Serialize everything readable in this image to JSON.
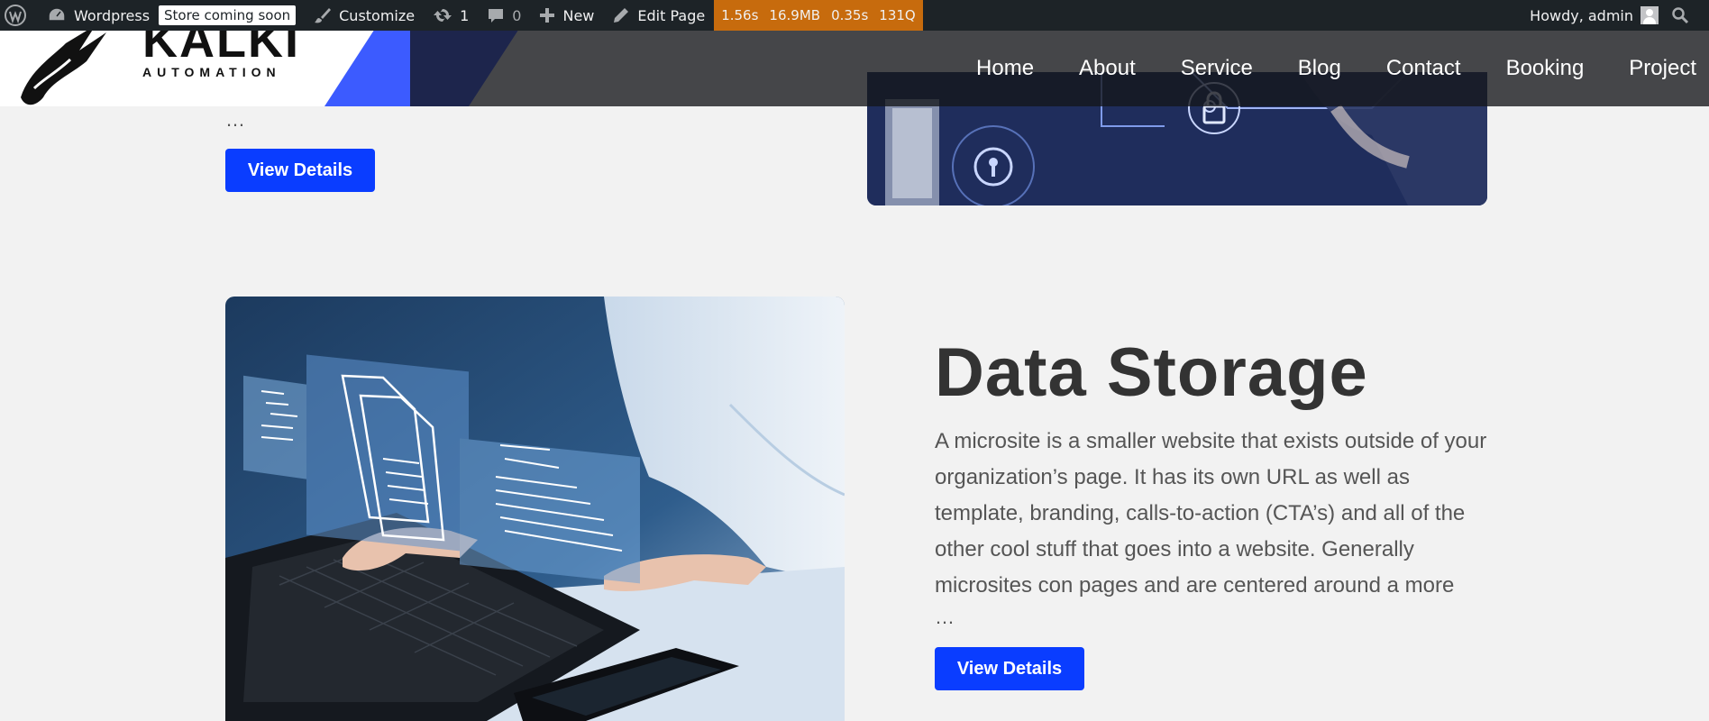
{
  "adminbar": {
    "site_name": "Wordpress",
    "store_badge": "Store coming soon",
    "customize": "Customize",
    "updates_count": "1",
    "comments_count": "0",
    "new_label": "New",
    "edit_page": "Edit Page",
    "perf": [
      "1.56s",
      "16.9MB",
      "0.35s",
      "131Q"
    ],
    "howdy": "Howdy, admin"
  },
  "header": {
    "logo_text": "KALKI",
    "logo_sub": "AUTOMATION",
    "nav": [
      "Home",
      "About",
      "Service",
      "Blog",
      "Contact",
      "Booking",
      "Project"
    ]
  },
  "previous_item": {
    "ellipsis": "…",
    "button": "View Details"
  },
  "service": {
    "title": "Data Storage",
    "description": "A microsite is a smaller website that exists outside of your organization’s page. It has its own URL as well as template, branding, calls-to-action (CTA’s) and all of the other cool stuff that goes into a website. Generally microsites con pages and are centered around a more",
    "ellipsis": "…",
    "button": "View Details"
  },
  "colors": {
    "accent": "#0a3dff",
    "admin_bar": "#1d2327",
    "perf_bar": "#c76b0d",
    "page_bg": "#f2f2f2"
  }
}
